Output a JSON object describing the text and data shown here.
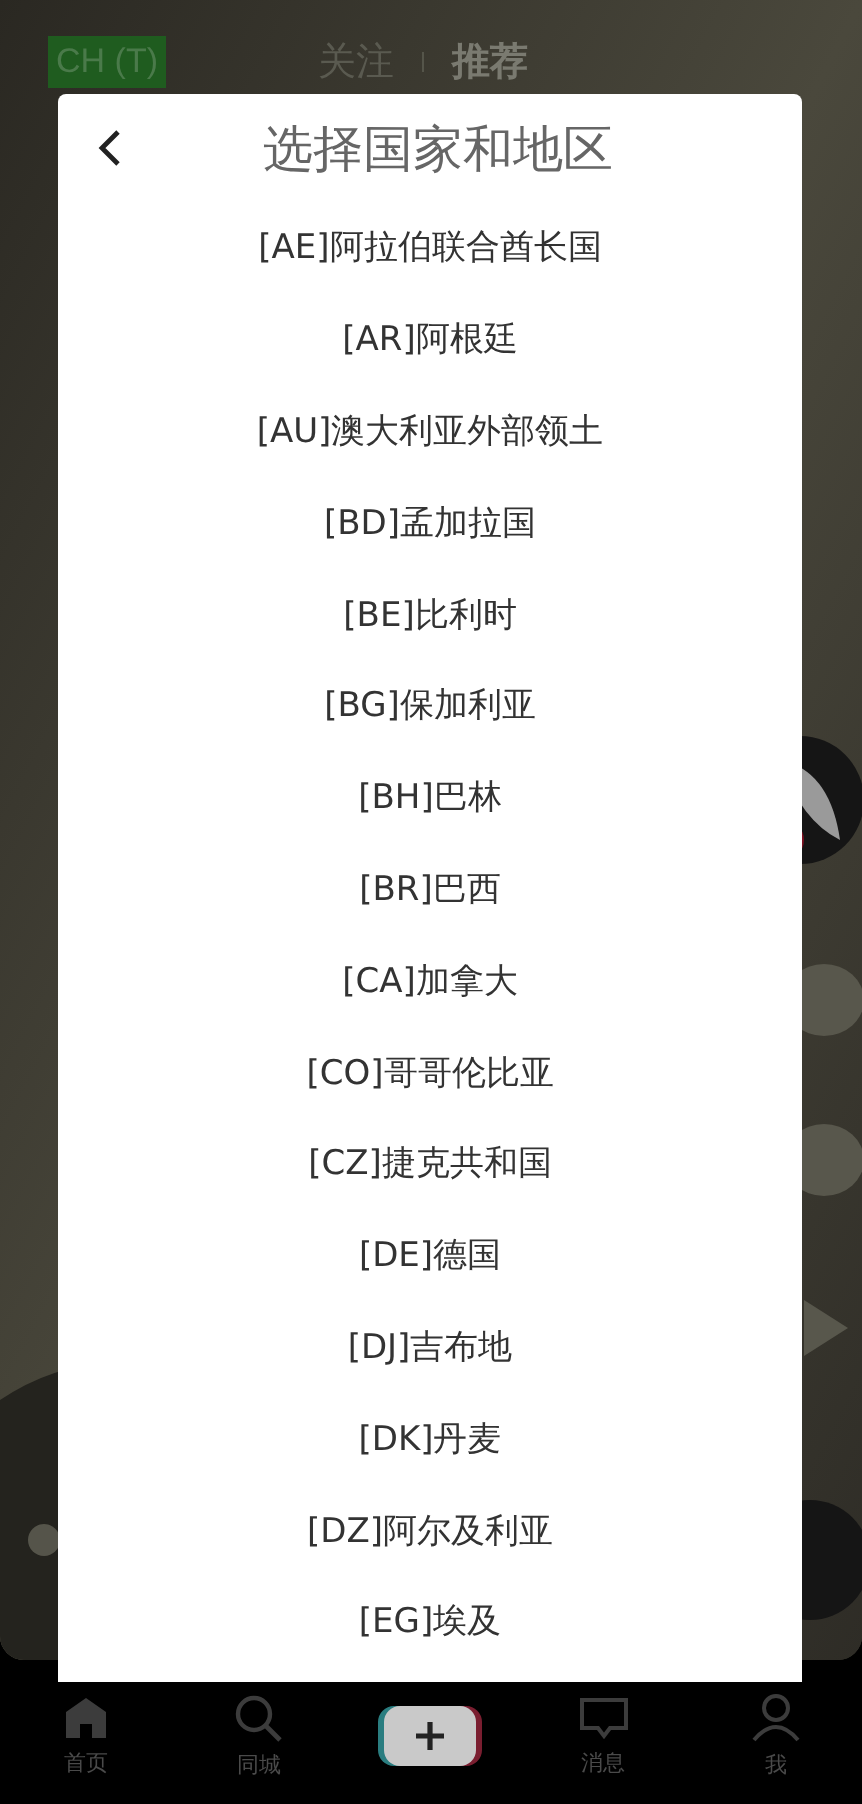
{
  "top_bar": {
    "badge": "CH (T)",
    "tabs": [
      {
        "label": "关注",
        "selected": false
      },
      {
        "label": "推荐",
        "selected": true
      }
    ]
  },
  "dialog": {
    "title": "选择国家和地区",
    "items": [
      "[AE]阿拉伯联合酋长国",
      "[AR]阿根廷",
      "[AU]澳大利亚外部领土",
      "[BD]孟加拉国",
      "[BE]比利时",
      "[BG]保加利亚",
      "[BH]巴林",
      "[BR]巴西",
      "[CA]加拿大",
      "[CO]哥哥伦比亚",
      "[CZ]捷克共和国",
      "[DE]德国",
      "[DJ]吉布地",
      "[DK]丹麦",
      "[DZ]阿尔及利亚",
      "[EG]埃及"
    ]
  },
  "bottom_nav": {
    "items": [
      {
        "kind": "home",
        "label": "首页"
      },
      {
        "kind": "search",
        "label": "同城"
      },
      {
        "kind": "add"
      },
      {
        "kind": "message",
        "label": "消息"
      },
      {
        "kind": "profile",
        "label": "我"
      }
    ]
  }
}
